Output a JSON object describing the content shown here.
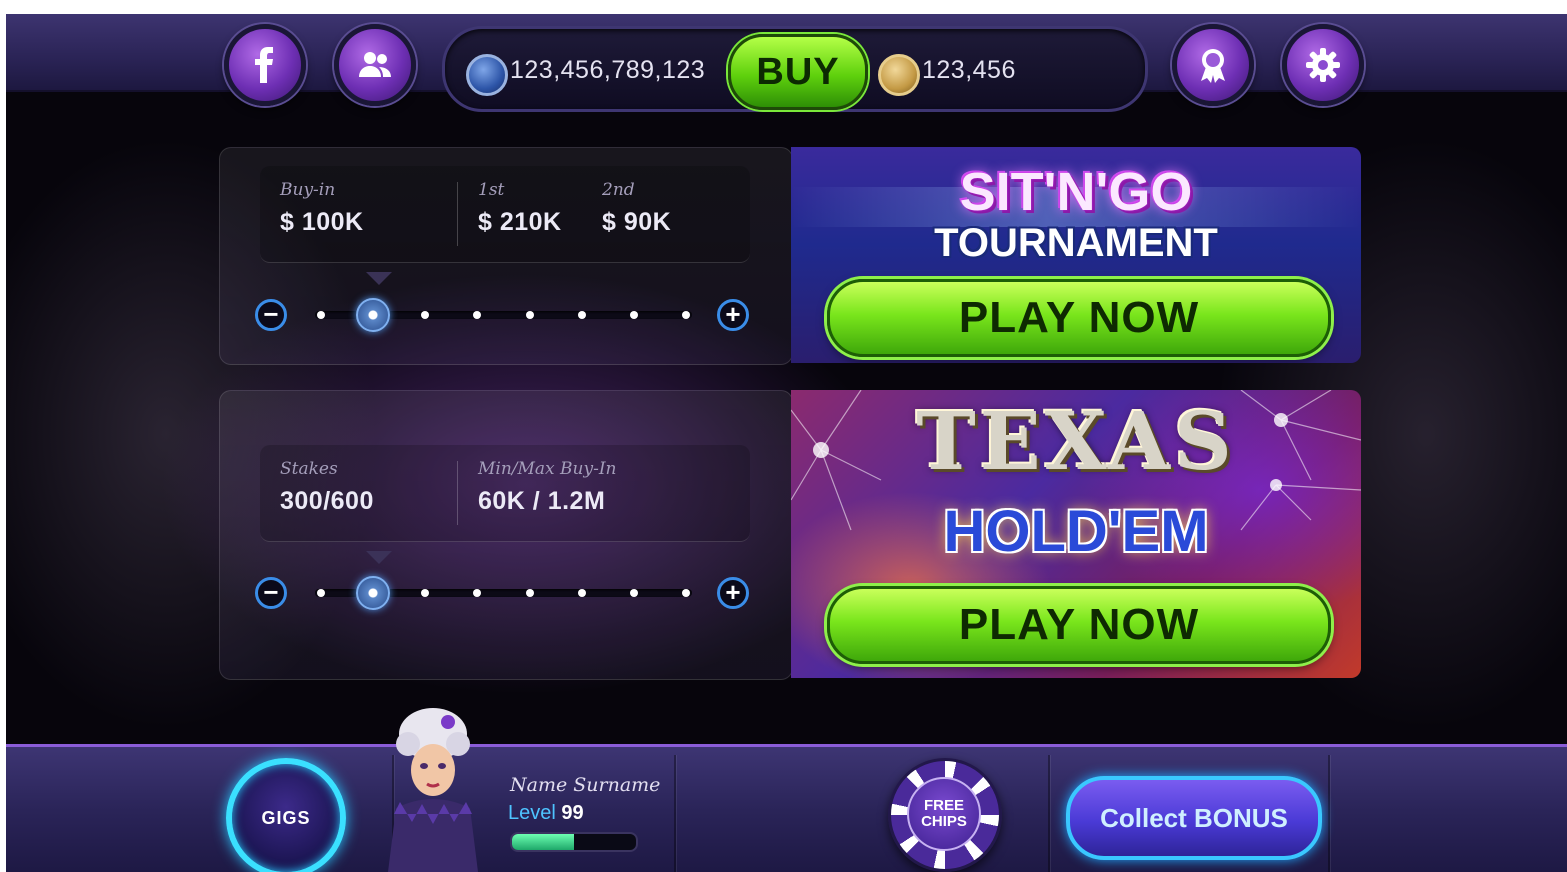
{
  "top_bar": {
    "chips_balance": "123,456,789,123",
    "buy_label": "BUY",
    "gold_balance": "123,456",
    "icons": {
      "facebook": "facebook-icon",
      "friends": "friends-icon",
      "achievements": "ribbon-icon",
      "settings": "gear-icon",
      "chip_currency": "blue-chip-icon",
      "gold_currency": "gold-coin-icon"
    }
  },
  "sitngo_panel": {
    "buyin_label": "Buy-in",
    "buyin_value": "$ 100K",
    "first_label": "1st",
    "first_value": "$ 210K",
    "second_label": "2nd",
    "second_value": "$ 90K",
    "slider": {
      "steps": 8,
      "selected_index": 1
    },
    "banner_line1": "SIT'N'GO",
    "banner_line2": "TOURNAMENT",
    "play_label": "PLAY NOW"
  },
  "holdem_panel": {
    "stakes_label": "Stakes",
    "stakes_value": "300/600",
    "minmax_label": "Min/Max Buy-In",
    "minmax_value": "60K / 1.2M",
    "slider": {
      "steps": 8,
      "selected_index": 1
    },
    "banner_line1": "TEXAS",
    "banner_line2": "HOLD'EM",
    "play_label": "PLAY NOW"
  },
  "bottom_bar": {
    "gigs_label": "GIGS",
    "player_name": "Name Surname",
    "level_label": "Level",
    "level_value": "99",
    "xp_progress": 0.5,
    "free_chips_line1": "FREE",
    "free_chips_line2": "CHIPS",
    "bonus_label": "Collect BONUS"
  },
  "colors": {
    "accent_green": "#7ae61c",
    "accent_blue": "#3ac8ff",
    "purple": "#6e2fb4"
  }
}
